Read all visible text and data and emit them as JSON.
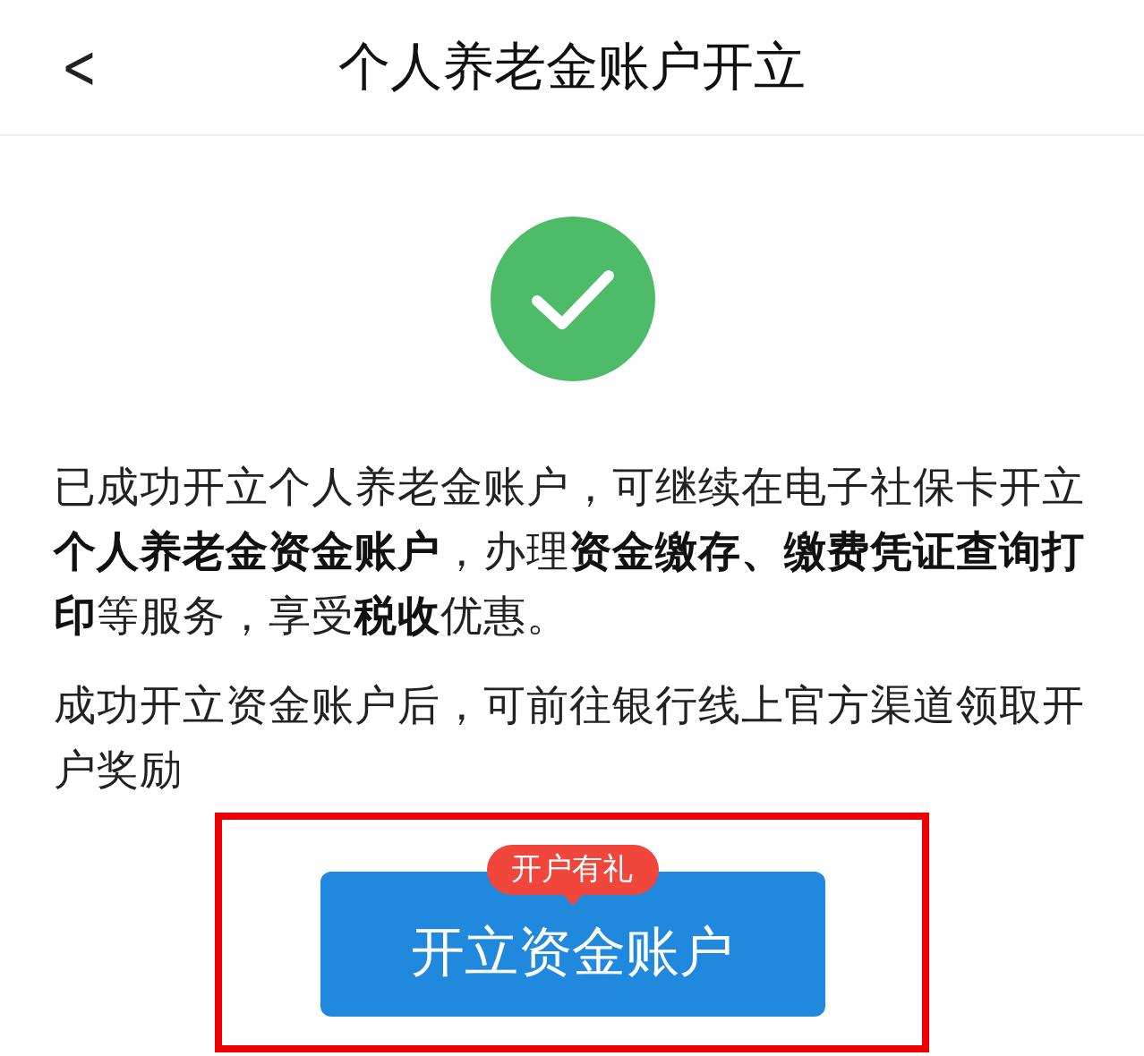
{
  "header": {
    "back": "<",
    "title": "个人养老金账户开立"
  },
  "paragraphs": [
    "已成功开立个人养老金账户，可继续在电子社保卡开立**个人养老金资金账户**，办理**资金缴存、缴费凭证查询打印**等服务，享受**税收**优惠。",
    "成功开立资金账户后，可前往银行线上官方渠道领取开户奖励"
  ],
  "button": {
    "label": "开立资金账户",
    "badge": "开户有礼"
  }
}
